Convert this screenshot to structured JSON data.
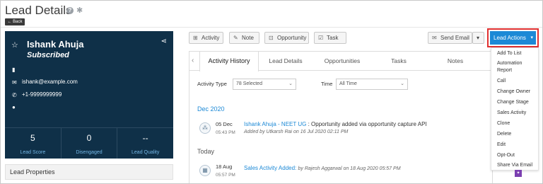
{
  "page": {
    "title": "Lead Details",
    "back_label": "← Back"
  },
  "lead": {
    "name": "Ishank Ahuja",
    "status": "Subscribed",
    "email": "ishank@example.com",
    "phone": "+1-9999999999",
    "stats": [
      {
        "value": "5",
        "label": "Lead Score"
      },
      {
        "value": "0",
        "label": "Disengaged"
      },
      {
        "value": "--",
        "label": "Lead Quality"
      }
    ],
    "properties_label": "Lead Properties"
  },
  "toolbar": {
    "activity": "Activity",
    "note": "Note",
    "opportunity": "Opportunity",
    "task": "Task",
    "send_email": "Send Email",
    "lead_actions": "Lead Actions"
  },
  "tabs": [
    "Activity History",
    "Lead Details",
    "Opportunities",
    "Tasks",
    "Notes"
  ],
  "filters": {
    "activity_type_label": "Activity Type",
    "activity_type_value": "78 Selected",
    "time_label": "Time",
    "time_value": "All Time"
  },
  "timeline": {
    "group1": "Dec 2020",
    "entry1": {
      "date": "05 Dec",
      "time": "05:43 PM",
      "link": "Ishank Ahuja - NEET UG",
      "text": ": Opportunity added via opportunity capture API",
      "meta": "Added by Utkarsh Rai on 16 Jul 2020 02:11 PM"
    },
    "group2": "Today",
    "entry2": {
      "date": "18 Aug",
      "time": "05:57 PM",
      "link": "Sales Activity Added:",
      "text": "by Rajesh Aggarwal on 18 Aug 2020 05:57 PM"
    }
  },
  "menu": {
    "items": [
      "Add To List",
      "Automation",
      "Report",
      "Call",
      "Change Owner",
      "Change Stage",
      "Sales Activity",
      "Clone",
      "Delete",
      "Edit",
      "Opt-Out",
      "Share Via Email"
    ]
  },
  "colors": {
    "accent": "#1c89d6",
    "card": "#0f3048",
    "highlight": "#e03030"
  }
}
